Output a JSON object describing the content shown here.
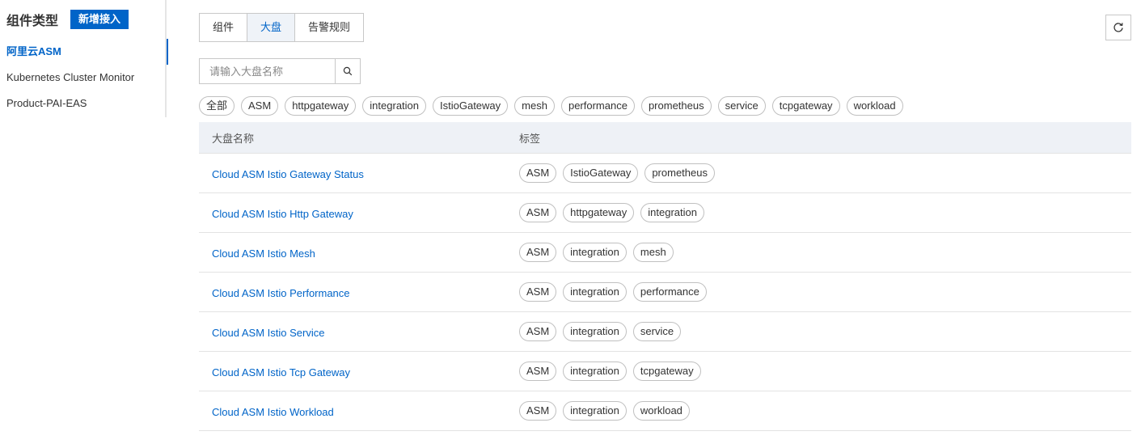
{
  "sidebar": {
    "title": "组件类型",
    "add_button": "新增接入",
    "items": [
      {
        "label": "阿里云ASM",
        "active": true
      },
      {
        "label": "Kubernetes Cluster Monitor",
        "active": false
      },
      {
        "label": "Product-PAI-EAS",
        "active": false
      }
    ]
  },
  "tabs": [
    {
      "label": "组件",
      "active": false
    },
    {
      "label": "大盘",
      "active": true
    },
    {
      "label": "告警规则",
      "active": false
    }
  ],
  "refresh_icon": "refresh-icon",
  "search": {
    "placeholder": "请输入大盘名称",
    "value": "",
    "icon": "search-icon"
  },
  "filters": [
    "全部",
    "ASM",
    "httpgateway",
    "integration",
    "IstioGateway",
    "mesh",
    "performance",
    "prometheus",
    "service",
    "tcpgateway",
    "workload"
  ],
  "table": {
    "columns": [
      "大盘名称",
      "标签"
    ],
    "rows": [
      {
        "name": "Cloud ASM Istio Gateway Status",
        "tags": [
          "ASM",
          "IstioGateway",
          "prometheus"
        ]
      },
      {
        "name": "Cloud ASM Istio Http Gateway",
        "tags": [
          "ASM",
          "httpgateway",
          "integration"
        ]
      },
      {
        "name": "Cloud ASM Istio Mesh",
        "tags": [
          "ASM",
          "integration",
          "mesh"
        ]
      },
      {
        "name": "Cloud ASM Istio Performance",
        "tags": [
          "ASM",
          "integration",
          "performance"
        ]
      },
      {
        "name": "Cloud ASM Istio Service",
        "tags": [
          "ASM",
          "integration",
          "service"
        ]
      },
      {
        "name": "Cloud ASM Istio Tcp Gateway",
        "tags": [
          "ASM",
          "integration",
          "tcpgateway"
        ]
      },
      {
        "name": "Cloud ASM Istio Workload",
        "tags": [
          "ASM",
          "integration",
          "workload"
        ]
      }
    ]
  },
  "colors": {
    "primary": "#0064c8",
    "header_bg": "#eef1f6",
    "tab_active_bg": "#eff3f8"
  }
}
